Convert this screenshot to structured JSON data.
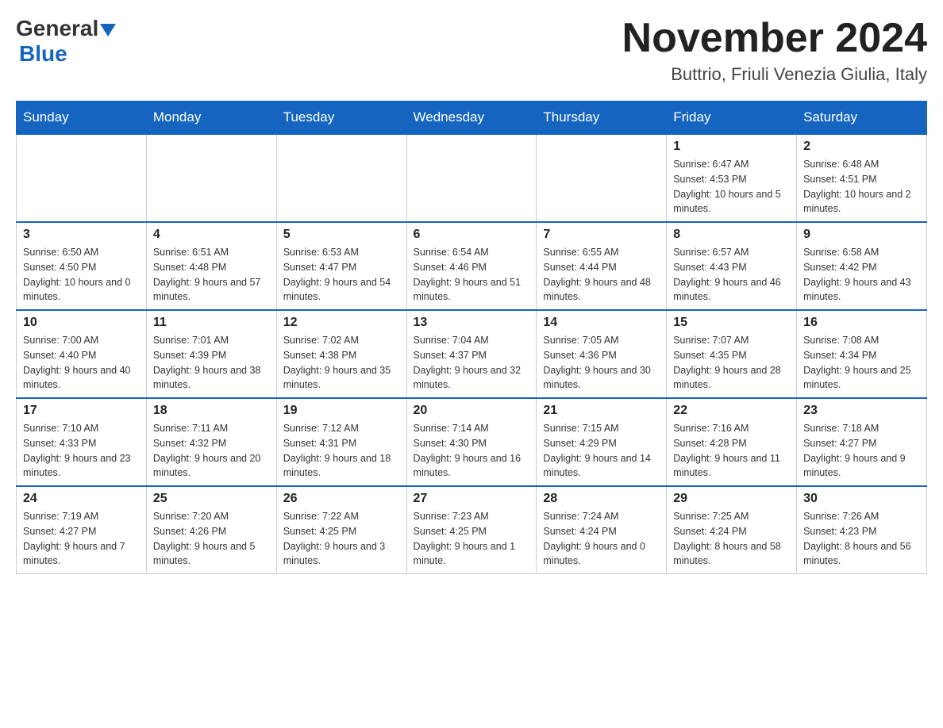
{
  "header": {
    "logo_general": "General",
    "logo_blue": "Blue",
    "title": "November 2024",
    "subtitle": "Buttrio, Friuli Venezia Giulia, Italy"
  },
  "days_of_week": [
    "Sunday",
    "Monday",
    "Tuesday",
    "Wednesday",
    "Thursday",
    "Friday",
    "Saturday"
  ],
  "weeks": [
    [
      {
        "day": "",
        "sunrise": "",
        "sunset": "",
        "daylight": ""
      },
      {
        "day": "",
        "sunrise": "",
        "sunset": "",
        "daylight": ""
      },
      {
        "day": "",
        "sunrise": "",
        "sunset": "",
        "daylight": ""
      },
      {
        "day": "",
        "sunrise": "",
        "sunset": "",
        "daylight": ""
      },
      {
        "day": "",
        "sunrise": "",
        "sunset": "",
        "daylight": ""
      },
      {
        "day": "1",
        "sunrise": "Sunrise: 6:47 AM",
        "sunset": "Sunset: 4:53 PM",
        "daylight": "Daylight: 10 hours and 5 minutes."
      },
      {
        "day": "2",
        "sunrise": "Sunrise: 6:48 AM",
        "sunset": "Sunset: 4:51 PM",
        "daylight": "Daylight: 10 hours and 2 minutes."
      }
    ],
    [
      {
        "day": "3",
        "sunrise": "Sunrise: 6:50 AM",
        "sunset": "Sunset: 4:50 PM",
        "daylight": "Daylight: 10 hours and 0 minutes."
      },
      {
        "day": "4",
        "sunrise": "Sunrise: 6:51 AM",
        "sunset": "Sunset: 4:48 PM",
        "daylight": "Daylight: 9 hours and 57 minutes."
      },
      {
        "day": "5",
        "sunrise": "Sunrise: 6:53 AM",
        "sunset": "Sunset: 4:47 PM",
        "daylight": "Daylight: 9 hours and 54 minutes."
      },
      {
        "day": "6",
        "sunrise": "Sunrise: 6:54 AM",
        "sunset": "Sunset: 4:46 PM",
        "daylight": "Daylight: 9 hours and 51 minutes."
      },
      {
        "day": "7",
        "sunrise": "Sunrise: 6:55 AM",
        "sunset": "Sunset: 4:44 PM",
        "daylight": "Daylight: 9 hours and 48 minutes."
      },
      {
        "day": "8",
        "sunrise": "Sunrise: 6:57 AM",
        "sunset": "Sunset: 4:43 PM",
        "daylight": "Daylight: 9 hours and 46 minutes."
      },
      {
        "day": "9",
        "sunrise": "Sunrise: 6:58 AM",
        "sunset": "Sunset: 4:42 PM",
        "daylight": "Daylight: 9 hours and 43 minutes."
      }
    ],
    [
      {
        "day": "10",
        "sunrise": "Sunrise: 7:00 AM",
        "sunset": "Sunset: 4:40 PM",
        "daylight": "Daylight: 9 hours and 40 minutes."
      },
      {
        "day": "11",
        "sunrise": "Sunrise: 7:01 AM",
        "sunset": "Sunset: 4:39 PM",
        "daylight": "Daylight: 9 hours and 38 minutes."
      },
      {
        "day": "12",
        "sunrise": "Sunrise: 7:02 AM",
        "sunset": "Sunset: 4:38 PM",
        "daylight": "Daylight: 9 hours and 35 minutes."
      },
      {
        "day": "13",
        "sunrise": "Sunrise: 7:04 AM",
        "sunset": "Sunset: 4:37 PM",
        "daylight": "Daylight: 9 hours and 32 minutes."
      },
      {
        "day": "14",
        "sunrise": "Sunrise: 7:05 AM",
        "sunset": "Sunset: 4:36 PM",
        "daylight": "Daylight: 9 hours and 30 minutes."
      },
      {
        "day": "15",
        "sunrise": "Sunrise: 7:07 AM",
        "sunset": "Sunset: 4:35 PM",
        "daylight": "Daylight: 9 hours and 28 minutes."
      },
      {
        "day": "16",
        "sunrise": "Sunrise: 7:08 AM",
        "sunset": "Sunset: 4:34 PM",
        "daylight": "Daylight: 9 hours and 25 minutes."
      }
    ],
    [
      {
        "day": "17",
        "sunrise": "Sunrise: 7:10 AM",
        "sunset": "Sunset: 4:33 PM",
        "daylight": "Daylight: 9 hours and 23 minutes."
      },
      {
        "day": "18",
        "sunrise": "Sunrise: 7:11 AM",
        "sunset": "Sunset: 4:32 PM",
        "daylight": "Daylight: 9 hours and 20 minutes."
      },
      {
        "day": "19",
        "sunrise": "Sunrise: 7:12 AM",
        "sunset": "Sunset: 4:31 PM",
        "daylight": "Daylight: 9 hours and 18 minutes."
      },
      {
        "day": "20",
        "sunrise": "Sunrise: 7:14 AM",
        "sunset": "Sunset: 4:30 PM",
        "daylight": "Daylight: 9 hours and 16 minutes."
      },
      {
        "day": "21",
        "sunrise": "Sunrise: 7:15 AM",
        "sunset": "Sunset: 4:29 PM",
        "daylight": "Daylight: 9 hours and 14 minutes."
      },
      {
        "day": "22",
        "sunrise": "Sunrise: 7:16 AM",
        "sunset": "Sunset: 4:28 PM",
        "daylight": "Daylight: 9 hours and 11 minutes."
      },
      {
        "day": "23",
        "sunrise": "Sunrise: 7:18 AM",
        "sunset": "Sunset: 4:27 PM",
        "daylight": "Daylight: 9 hours and 9 minutes."
      }
    ],
    [
      {
        "day": "24",
        "sunrise": "Sunrise: 7:19 AM",
        "sunset": "Sunset: 4:27 PM",
        "daylight": "Daylight: 9 hours and 7 minutes."
      },
      {
        "day": "25",
        "sunrise": "Sunrise: 7:20 AM",
        "sunset": "Sunset: 4:26 PM",
        "daylight": "Daylight: 9 hours and 5 minutes."
      },
      {
        "day": "26",
        "sunrise": "Sunrise: 7:22 AM",
        "sunset": "Sunset: 4:25 PM",
        "daylight": "Daylight: 9 hours and 3 minutes."
      },
      {
        "day": "27",
        "sunrise": "Sunrise: 7:23 AM",
        "sunset": "Sunset: 4:25 PM",
        "daylight": "Daylight: 9 hours and 1 minute."
      },
      {
        "day": "28",
        "sunrise": "Sunrise: 7:24 AM",
        "sunset": "Sunset: 4:24 PM",
        "daylight": "Daylight: 9 hours and 0 minutes."
      },
      {
        "day": "29",
        "sunrise": "Sunrise: 7:25 AM",
        "sunset": "Sunset: 4:24 PM",
        "daylight": "Daylight: 8 hours and 58 minutes."
      },
      {
        "day": "30",
        "sunrise": "Sunrise: 7:26 AM",
        "sunset": "Sunset: 4:23 PM",
        "daylight": "Daylight: 8 hours and 56 minutes."
      }
    ]
  ]
}
